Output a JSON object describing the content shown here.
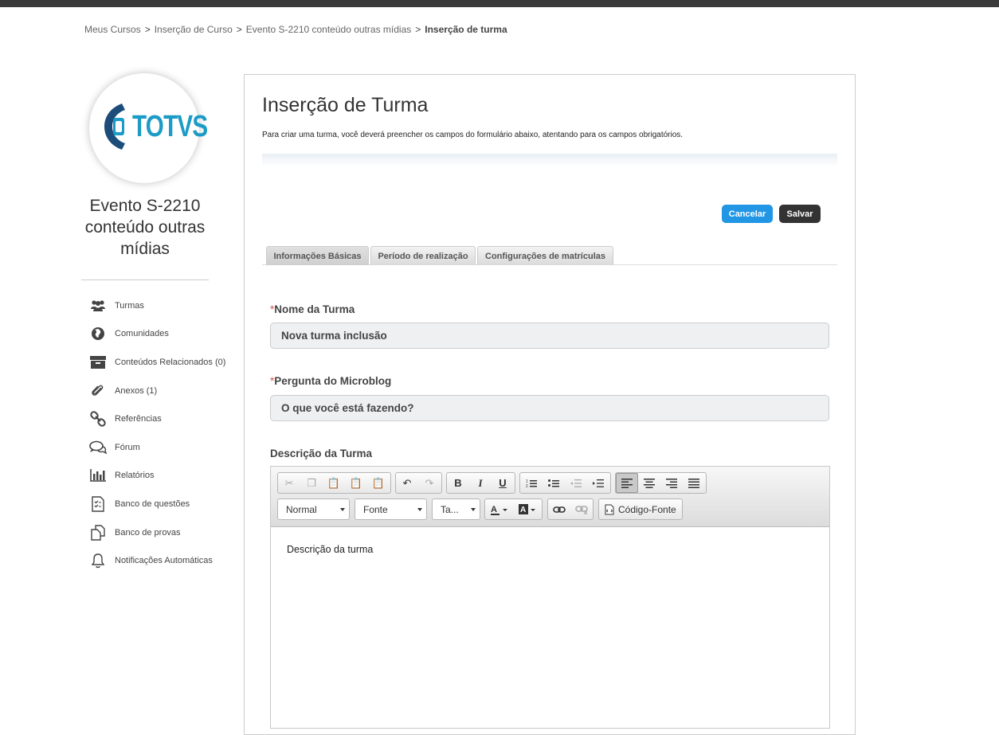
{
  "breadcrumb": {
    "item1": "Meus Cursos",
    "item2": "Inserção de Curso",
    "item3": "Evento S-2210 conteúdo outras mídias",
    "current": "Inserção de turma",
    "separator": ">"
  },
  "sidebar": {
    "logo_text": "TOTVS",
    "course_title": "Evento S-2210 conteúdo outras mídias",
    "items": [
      {
        "label": "Turmas",
        "icon": "users-icon"
      },
      {
        "label": "Comunidades",
        "icon": "globe-icon"
      },
      {
        "label": "Conteúdos Relacionados (0)",
        "icon": "archive-icon"
      },
      {
        "label": "Anexos (1)",
        "icon": "paperclip-icon"
      },
      {
        "label": "Referências",
        "icon": "link-icon"
      },
      {
        "label": "Fórum",
        "icon": "chat-icon"
      },
      {
        "label": "Relatórios",
        "icon": "bar-chart-icon"
      },
      {
        "label": "Banco de questões",
        "icon": "checklist-icon"
      },
      {
        "label": "Banco de provas",
        "icon": "copy-icon"
      },
      {
        "label": "Notificações Automáticas",
        "icon": "bell-icon"
      }
    ]
  },
  "main": {
    "title": "Inserção de Turma",
    "description": "Para criar uma turma, você deverá preencher os campos do formulário abaixo, atentando para os campos obrigatórios.",
    "cancel_label": "Cancelar",
    "save_label": "Salvar",
    "tabs": [
      {
        "label": "Informações Básicas",
        "active": true
      },
      {
        "label": "Período de realização",
        "active": false
      },
      {
        "label": "Configurações de matrículas",
        "active": false
      }
    ],
    "fields": {
      "nome_label": "Nome da Turma",
      "nome_value": "Nova turma inclusão",
      "pergunta_label": "Pergunta do Microblog",
      "pergunta_value": "O que você está fazendo?",
      "required_mark": "*",
      "descricao_label": "Descrição da Turma"
    },
    "editor": {
      "format_select": "Normal",
      "font_select": "Fonte",
      "size_select": "Ta...",
      "source_button": "Código-Fonte",
      "body_text": "Descrição da turma"
    }
  },
  "colors": {
    "topbar": "#3a3a3a",
    "cancel_button": "#2196e4",
    "save_button": "#333333",
    "logo_blue": "#1c9bc6",
    "required": "#d9534f"
  }
}
